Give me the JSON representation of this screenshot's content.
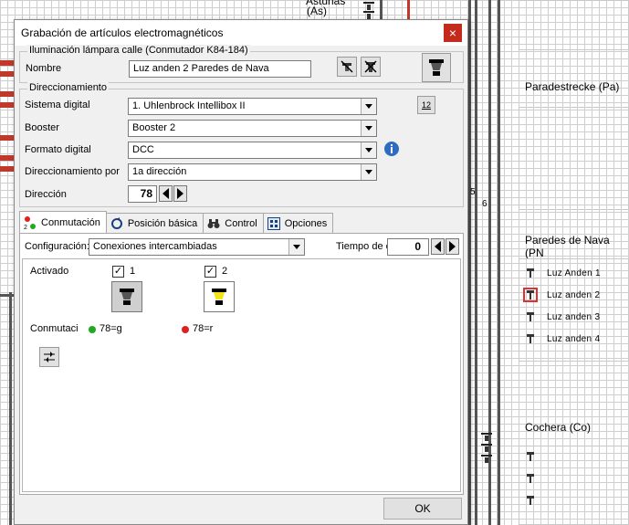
{
  "background": {
    "top_label_1": "Asturias",
    "top_label_2": "(As)",
    "section_paradestrecke": "Paradestrecke (Pa)",
    "section_paredes": "Paredes de Nava (PN",
    "section_cochera": "Cochera (Co)",
    "lamp_items": [
      "Luz Anden 1",
      "Luz anden 2",
      "Luz anden 3",
      "Luz anden 4"
    ],
    "track_number_1": "5",
    "track_number_2": "6"
  },
  "dialog": {
    "title": "Grabación de artículos electromagnéticos",
    "close_symbol": "×",
    "group_lamp": {
      "title": "Iluminación lámpara calle (Conmutador K84-184)",
      "name_label": "Nombre",
      "name_value": "Luz anden 2 Paredes de Nava"
    },
    "group_addressing": {
      "title": "Direccionamiento",
      "digital_system_label": "Sistema digital",
      "digital_system_value": "1. Uhlenbrock Intellibox II",
      "booster_label": "Booster",
      "booster_value": "Booster 2",
      "format_label": "Formato digital",
      "format_value": "DCC",
      "addr_by_label": "Direccionamiento por",
      "addr_by_value": "1a dirección",
      "address_label": "Dirección",
      "address_value": "78",
      "addr_button_text": "12"
    },
    "tabs": [
      {
        "label": "Conmutación",
        "icon": "switch-lights-icon"
      },
      {
        "label": "Posición básica",
        "icon": "reset-icon"
      },
      {
        "label": "Control",
        "icon": "binoculars-icon"
      },
      {
        "label": "Opciones",
        "icon": "options-grid-icon"
      }
    ],
    "switching": {
      "config_label": "Configuración:",
      "config_value": "Conexiones intercambiadas",
      "time_label": "Tiempo de c",
      "time_value": "0",
      "activated_label": "Activado",
      "state1_check": "✓",
      "state1_num": "1",
      "state2_check": "✓",
      "state2_num": "2",
      "switching_label": "Conmutaci",
      "addr1": "78=g",
      "addr2": "78=r",
      "dot1_color": "#1faa1f",
      "dot2_color": "#e02020",
      "lamp_on_color": "#f5e21a"
    },
    "ok_label": "OK"
  }
}
